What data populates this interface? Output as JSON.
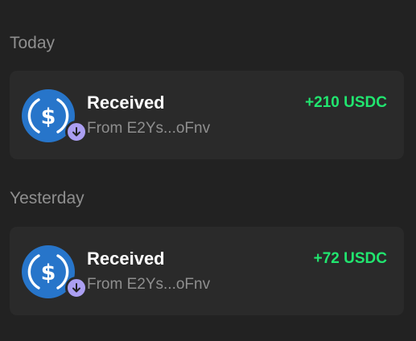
{
  "sections": [
    {
      "title": "Today",
      "transactions": [
        {
          "title": "Received",
          "subtitle": "From E2Ys...oFnv",
          "amount": "+210 USDC",
          "token_icon": "usdc-coin-icon",
          "badge_icon": "arrow-down-icon"
        }
      ]
    },
    {
      "title": "Yesterday",
      "transactions": [
        {
          "title": "Received",
          "subtitle": "From E2Ys...oFnv",
          "amount": "+72 USDC",
          "token_icon": "usdc-coin-icon",
          "badge_icon": "arrow-down-icon"
        }
      ]
    }
  ],
  "colors": {
    "background": "#222222",
    "card": "#2a2a2a",
    "positive_amount": "#21e56f",
    "usdc_blue": "#2775ca",
    "badge_purple": "#ab9ff2"
  }
}
